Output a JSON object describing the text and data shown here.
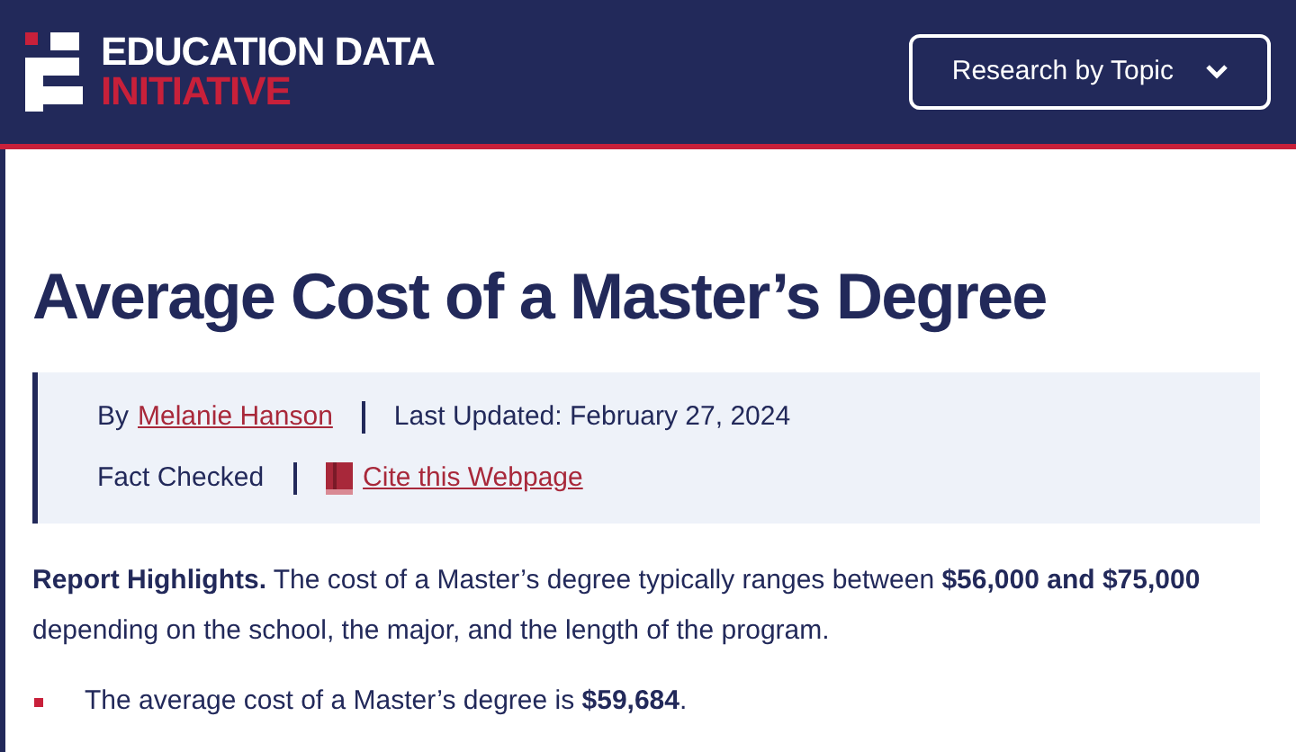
{
  "header": {
    "logo_line_1": "EDUCATION DATA",
    "logo_line_2": "INITIATIVE",
    "menu_button": "Research by Topic"
  },
  "title": "Average Cost of a Master’s Degree",
  "meta": {
    "by": "By",
    "author": "Melanie Hanson",
    "updated": "Last Updated: February 27, 2024",
    "fact_checked": "Fact Checked",
    "cite": "Cite this Webpage"
  },
  "highlights": "**Report Highlights.** The cost of a Master’s degree typically ranges between **$56,000 and $75,000** depending on the school, the major, and the length of the program.",
  "bullets": [
    "The average cost of a Master’s degree is **$59,684**."
  ]
}
